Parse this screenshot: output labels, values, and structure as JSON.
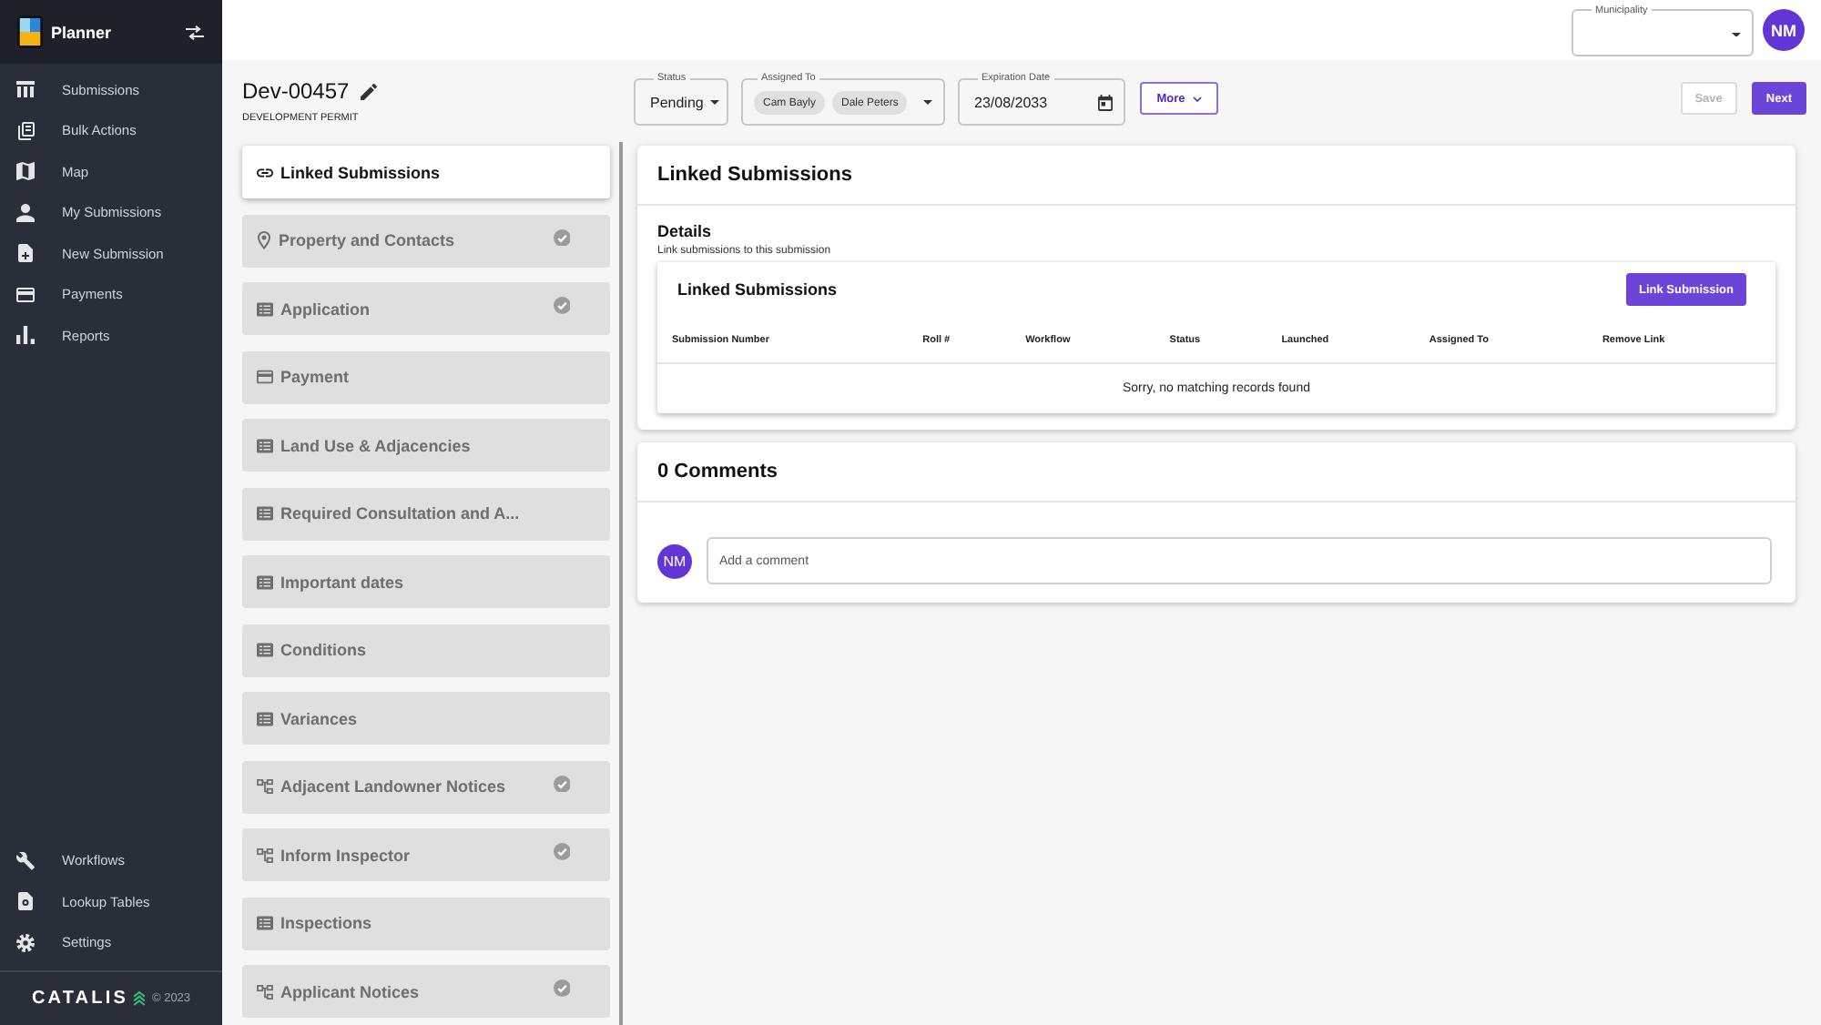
{
  "sidebar": {
    "app_name": "Planner",
    "nav_items": [
      {
        "label": "Submissions"
      },
      {
        "label": "Bulk Actions"
      },
      {
        "label": "Map"
      },
      {
        "label": "My Submissions"
      },
      {
        "label": "New Submission"
      },
      {
        "label": "Payments"
      },
      {
        "label": "Reports"
      }
    ],
    "bottom_items": [
      {
        "label": "Workflows"
      },
      {
        "label": "Lookup Tables"
      },
      {
        "label": "Settings"
      }
    ],
    "footer": {
      "brand": "CATALIS",
      "copyright": "© 2023"
    }
  },
  "top_bar": {
    "municipality": {
      "label": "Municipality"
    },
    "avatar": "NM"
  },
  "submission": {
    "title": "Dev-00457",
    "type": "DEVELOPMENT PERMIT"
  },
  "fields": {
    "status": {
      "label": "Status",
      "value": "Pending"
    },
    "assigned_to": {
      "label": "Assigned To",
      "chips": [
        "Cam Bayly",
        "Dale Peters"
      ]
    },
    "expiration_date": {
      "label": "Expiration Date",
      "value": "23/08/2033"
    }
  },
  "more_button": {
    "label": "More"
  },
  "buttons": [
    {
      "label": "Save",
      "disabled": true
    },
    {
      "label": "Next",
      "disabled": false
    }
  ],
  "sections": [
    {
      "label": "Linked Submissions",
      "kind": "link",
      "selected": true,
      "completed": false
    },
    {
      "label": "Property and Contacts",
      "kind": "location",
      "selected": false,
      "completed": true
    },
    {
      "label": "Application",
      "kind": "form",
      "selected": false,
      "completed": true
    },
    {
      "label": "Payment",
      "kind": "payment",
      "selected": false,
      "completed": false
    },
    {
      "label": "Land Use & Adjacencies",
      "kind": "form",
      "selected": false,
      "completed": false
    },
    {
      "label": "Required Consultation and A...",
      "kind": "form",
      "selected": false,
      "completed": false
    },
    {
      "label": "Important dates",
      "kind": "form",
      "selected": false,
      "completed": false
    },
    {
      "label": "Conditions",
      "kind": "form",
      "selected": false,
      "completed": false
    },
    {
      "label": "Variances",
      "kind": "form",
      "selected": false,
      "completed": false
    },
    {
      "label": "Adjacent Landowner Notices",
      "kind": "workflow",
      "selected": false,
      "completed": true
    },
    {
      "label": "Inform Inspector",
      "kind": "workflow",
      "selected": false,
      "completed": true
    },
    {
      "label": "Inspections",
      "kind": "form",
      "selected": false,
      "completed": false
    },
    {
      "label": "Applicant Notices",
      "kind": "workflow",
      "selected": false,
      "completed": true
    }
  ],
  "linked_card": {
    "title": "Linked Submissions",
    "details_heading": "Details",
    "details_text": "Link submissions to this submission",
    "table": {
      "title": "Linked Submissions",
      "button": "Link Submission",
      "columns": [
        "Submission Number",
        "Roll #",
        "Workflow",
        "Status",
        "Launched",
        "Assigned To",
        "Remove Link"
      ],
      "empty_message": "Sorry, no matching records found"
    }
  },
  "comments": {
    "title": "0 Comments",
    "avatar": "NM",
    "placeholder": "Add a comment"
  }
}
